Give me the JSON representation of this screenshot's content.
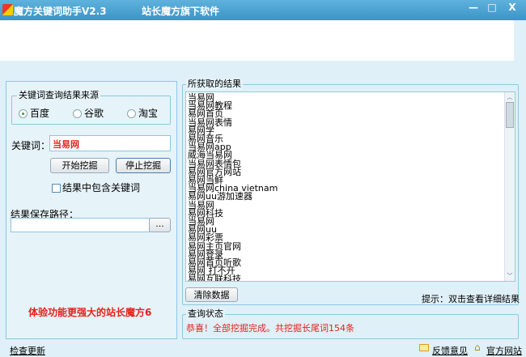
{
  "window": {
    "title": "魔方关键词助手V2.3",
    "subtitle": "站长魔方旗下软件",
    "minimize": "—",
    "maximize": "□",
    "close": "X"
  },
  "left": {
    "source_group": "关键词查询结果来源",
    "sources": [
      {
        "label": "百度",
        "selected": true
      },
      {
        "label": "谷歌",
        "selected": false
      },
      {
        "label": "淘宝",
        "selected": false
      }
    ],
    "keyword_label": "关键词：",
    "keyword_value": "当易网",
    "start_button": "开始挖掘",
    "stop_button": "停止挖掘",
    "include_checkbox": "结果中包含关键词",
    "include_checked": false,
    "path_label": "结果保存路径：",
    "path_value": "",
    "browse_button": "...",
    "promo": "体验功能更强大的站长魔方6"
  },
  "results": {
    "group": "所获取的结果",
    "items": [
      "当易网",
      "当易网教程",
      "易网首页",
      "当易网表情",
      "易网学",
      "易网音乐",
      "当易网app",
      "威海当易网",
      "当易网表情包",
      "易网官方网站",
      "易网当鲜",
      "当易网china vietnam",
      "易网uu游加速器",
      "当易网",
      "易网科技",
      "当易网",
      "易网uu",
      "易网彩票",
      "易网主页官网",
      "易网登录",
      "易网首页听歌",
      "易网 打不开",
      "易网互联科技"
    ],
    "clear_button": "清除数据",
    "hint": "提示：双击查看详细结果"
  },
  "status": {
    "group": "查询状态",
    "message": "恭喜！全部挖掘完成。共挖掘长尾词154条"
  },
  "footer": {
    "check_update": "检查更新",
    "feedback": "反馈意见",
    "website": "官方网站"
  }
}
